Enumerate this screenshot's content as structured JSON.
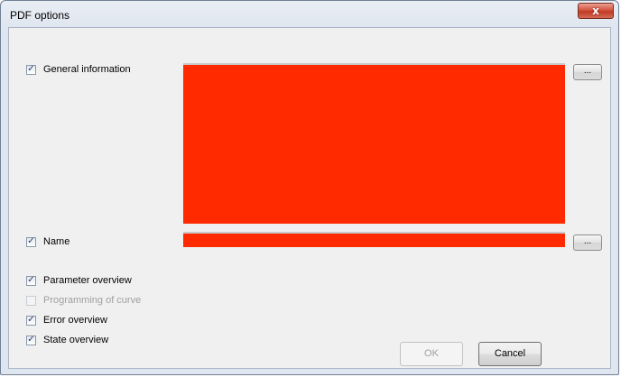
{
  "window": {
    "title": "PDF options",
    "close_glyph": "x"
  },
  "options": [
    {
      "label": "General information",
      "checked": true,
      "enabled": true
    },
    {
      "label": "Name",
      "checked": true,
      "enabled": true
    },
    {
      "label": "Parameter overview",
      "checked": true,
      "enabled": true
    },
    {
      "label": "Programming of curve",
      "checked": false,
      "enabled": false
    },
    {
      "label": "Error overview",
      "checked": true,
      "enabled": true
    },
    {
      "label": "State overview",
      "checked": true,
      "enabled": true
    }
  ],
  "browse_label": "...",
  "buttons": {
    "ok": "OK",
    "cancel": "Cancel"
  },
  "colors": {
    "preview_fill": "#ff2a00"
  },
  "check_glyph": "✓"
}
